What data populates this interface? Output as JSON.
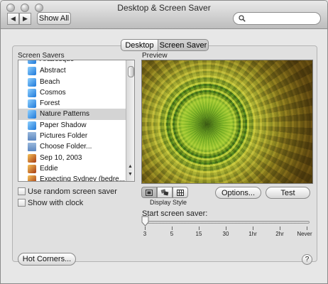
{
  "window": {
    "title": "Desktop & Screen Saver"
  },
  "toolbar": {
    "show_all": "Show All",
    "back_icon": "chevron-left-icon",
    "forward_icon": "chevron-right-icon",
    "search_icon": "magnifier-icon"
  },
  "tabs": [
    {
      "label": "Desktop"
    },
    {
      "label": "Screen Saver",
      "selected": true
    }
  ],
  "list": {
    "header": "Screen Savers",
    "partial_top": "Arabesque",
    "items": [
      {
        "label": "Abstract",
        "icon": "screensaver-icon"
      },
      {
        "label": "Beach",
        "icon": "screensaver-icon"
      },
      {
        "label": "Cosmos",
        "icon": "screensaver-icon"
      },
      {
        "label": "Forest",
        "icon": "screensaver-icon"
      },
      {
        "label": "Nature Patterns",
        "icon": "screensaver-icon",
        "selected": true
      },
      {
        "label": "Paper Shadow",
        "icon": "screensaver-icon"
      },
      {
        "label": "Pictures Folder",
        "icon": "folder-icon"
      },
      {
        "label": "Choose Folder...",
        "icon": "folder-icon"
      },
      {
        "label": "Sep 10, 2003",
        "icon": "photo-album-icon"
      },
      {
        "label": "Eddie",
        "icon": "photo-album-icon"
      },
      {
        "label": "Expecting Sydney (bedre...",
        "icon": "photo-album-icon"
      }
    ]
  },
  "options": {
    "random": "Use random screen saver",
    "clock": "Show with clock"
  },
  "preview": {
    "label": "Preview"
  },
  "display_style": {
    "label": "Display Style",
    "selected": "slideshow"
  },
  "buttons": {
    "options": "Options...",
    "test": "Test",
    "hot_corners": "Hot Corners...",
    "help": "?"
  },
  "slider": {
    "label": "Start screen saver:",
    "ticks": [
      "3",
      "5",
      "15",
      "30",
      "1hr",
      "2hr",
      "Never"
    ],
    "value": "3"
  },
  "colors": {
    "selection": "#d4d4d4",
    "window": "#e7e7e7"
  }
}
